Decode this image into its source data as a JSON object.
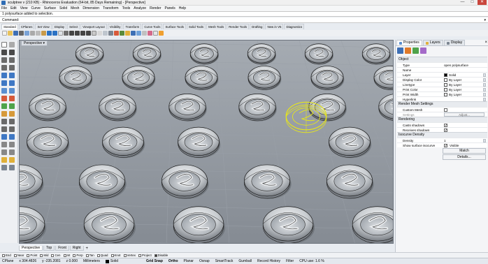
{
  "window": {
    "title": "sculptree v (210 KB) - Rhinoceros Evaluation (64-bit, 85 Days Remaining) - [Perspective]",
    "minimize": "—",
    "maximize": "□",
    "close": "✕"
  },
  "menu": [
    "File",
    "Edit",
    "View",
    "Curve",
    "Surface",
    "Solid",
    "Mesh",
    "Dimension",
    "Transform",
    "Tools",
    "Analyze",
    "Render",
    "Panels",
    "Help"
  ],
  "command": {
    "history": "1 polysurface added to selection.",
    "label": "Command:",
    "value": ""
  },
  "tool_tabs": [
    "Standard",
    "CPlanes",
    "Set View",
    "Display",
    "Select",
    "Viewport Layout",
    "Visibility",
    "Transform",
    "Curve Tools",
    "Surface Tools",
    "Solid Tools",
    "Mesh Tools",
    "Render Tools",
    "Drafting",
    "New in V5",
    "Diagnostics"
  ],
  "viewport": {
    "label": "Perspective ▾",
    "tabs": [
      "Perspective",
      "Top",
      "Front",
      "Right"
    ],
    "add_tab": "+"
  },
  "osnaps": [
    {
      "label": "End",
      "on": false
    },
    {
      "label": "Near",
      "on": false
    },
    {
      "label": "Point",
      "on": false
    },
    {
      "label": "Mid",
      "on": false
    },
    {
      "label": "Cen",
      "on": false
    },
    {
      "label": "Int",
      "on": false
    },
    {
      "label": "Perp",
      "on": false
    },
    {
      "label": "Tan",
      "on": false
    },
    {
      "label": "Quad",
      "on": false
    },
    {
      "label": "Knot",
      "on": false
    },
    {
      "label": "Vertex",
      "on": false
    },
    {
      "label": "Project",
      "on": false
    },
    {
      "label": "Disable",
      "on": true
    }
  ],
  "status": {
    "cplane": "CPlane",
    "x": "x 304.4826",
    "y": "y -235.2081",
    "z": "z 0.000",
    "units": "Millimeters",
    "layer": "Solid",
    "grid_snap": "Grid Snap",
    "ortho": "Ortho",
    "planar": "Planar",
    "osnap": "Osnap",
    "smarttrack": "SmartTrack",
    "gumball": "Gumball",
    "record_history": "Record History",
    "filter": "Filter",
    "cpu": "CPU use: 1.6 %"
  },
  "panel": {
    "tabs": [
      "Properties",
      "Layers",
      "Display"
    ],
    "sections": {
      "object": "Object",
      "render_mesh": "Render Mesh Settings",
      "rendering": "Rendering",
      "isocurve": "Isocurve Density"
    },
    "object_rows": [
      {
        "key": "Type",
        "value": "open polysurface"
      },
      {
        "key": "Name",
        "value": ""
      },
      {
        "key": "Layer",
        "value": "Solid"
      },
      {
        "key": "Display Color",
        "value": "By Layer"
      },
      {
        "key": "Linetype",
        "value": "By Layer"
      },
      {
        "key": "Print Color",
        "value": "By Layer"
      },
      {
        "key": "Print Width",
        "value": "By Layer"
      },
      {
        "key": "Hyperlink",
        "value": ""
      }
    ],
    "custom_mesh": "Custom Mesh",
    "settings_label": "Settings",
    "adjust_button": "Adjust...",
    "casts_shadows": "Casts shadows",
    "receives_shadows": "Receives shadows",
    "density_label": "Density",
    "density_value": "1",
    "show_isocurve": "Show surface isocurve",
    "visible_label": "Visible",
    "match_button": "Match",
    "details_button": "Details...",
    "colors": {
      "layer_swatch": "#000000",
      "bylayer_swatch": "#ffffff"
    }
  },
  "colors": {
    "viewport_bg": "#8e949c",
    "selection": "#e6e61a",
    "accent": "#2f6db5"
  }
}
